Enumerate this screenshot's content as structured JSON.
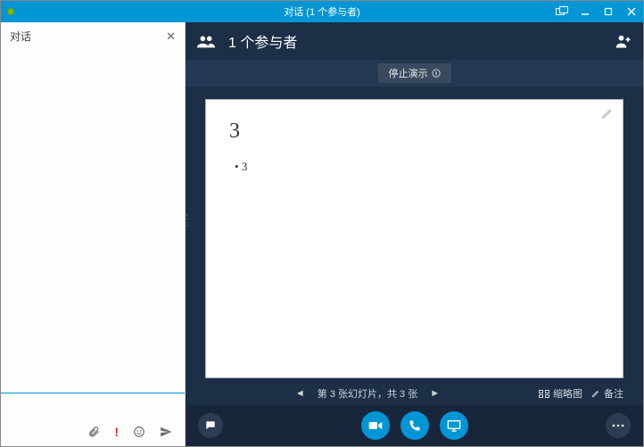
{
  "titlebar": {
    "title": "对话 (1 个参与者)"
  },
  "conversation": {
    "header_label": "对话",
    "input_value": "",
    "input_placeholder": ""
  },
  "stage": {
    "participants_label": "1 个参与者",
    "stop_button_label": "停止演示",
    "slide": {
      "heading": "3",
      "bullet": "3"
    },
    "nav": {
      "status": "第 3 张幻灯片，共 3 张",
      "thumbnails_label": "缩略图",
      "notes_label": "备注"
    }
  },
  "icons": {
    "participants": "participants-icon",
    "add_person": "add-person-icon",
    "pencil": "pencil-icon",
    "attach": "paperclip-icon",
    "priority": "priority-icon",
    "emoji": "emoji-icon",
    "send": "send-icon",
    "chat": "chat-icon",
    "video": "video-icon",
    "call": "call-icon",
    "present": "present-icon",
    "more": "more-icon",
    "popout": "popout-icon",
    "minimize": "minimize-icon",
    "maximize": "maximize-icon",
    "close": "close-icon",
    "thumbs": "thumbnails-icon",
    "notes": "notes-icon",
    "info": "info-icon"
  }
}
